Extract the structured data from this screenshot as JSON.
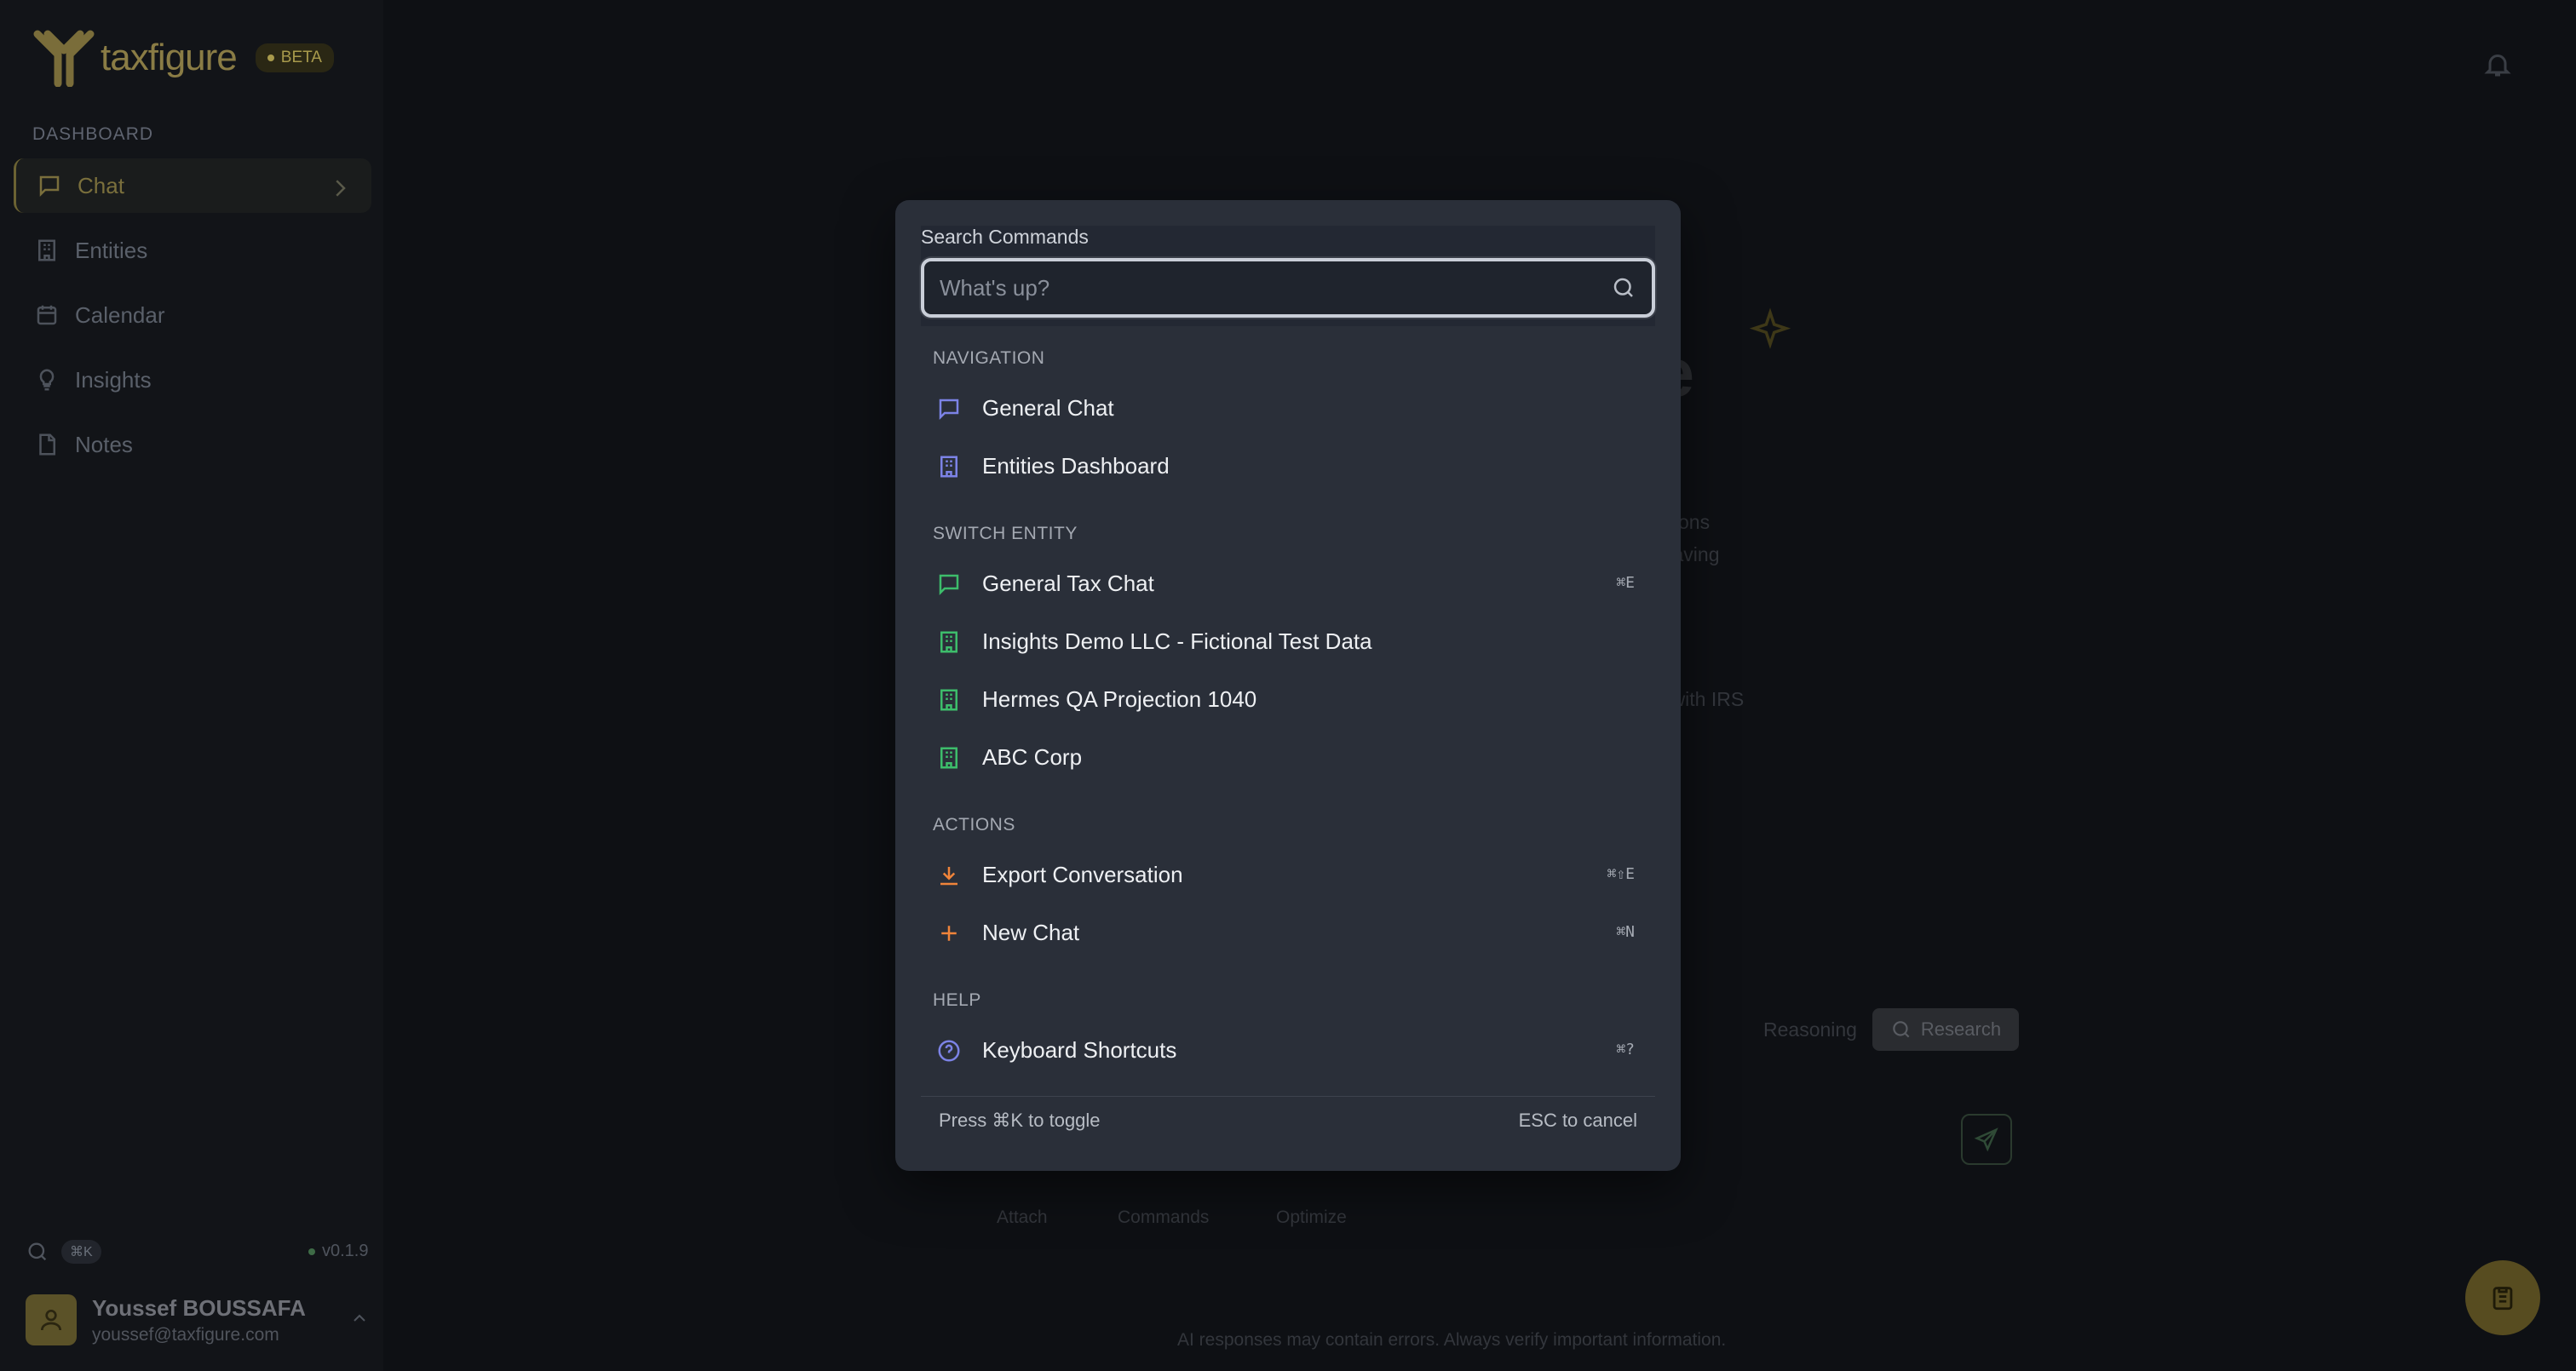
{
  "brand": {
    "name": "taxfigure",
    "badge": "BETA"
  },
  "sidebar": {
    "section_label": "DASHBOARD",
    "items": [
      {
        "label": "Chat",
        "icon": "chat-bubble-icon"
      },
      {
        "label": "Entities",
        "icon": "building-icon"
      },
      {
        "label": "Calendar",
        "icon": "calendar-icon"
      },
      {
        "label": "Insights",
        "icon": "lightbulb-icon"
      },
      {
        "label": "Notes",
        "icon": "note-icon"
      }
    ],
    "search_shortcut": "⌘K",
    "version": "v0.1.9",
    "user": {
      "name": "Youssef BOUSSAFA",
      "email": "youssef@taxfigure.com"
    }
  },
  "background": {
    "hero_text": "ce",
    "line1": "ons",
    "line2": "saving",
    "line3": "nt with IRS",
    "mode_reasoning": "Reasoning",
    "mode_research": "Research",
    "footer_attach": "Attach",
    "footer_commands": "Commands",
    "footer_optimize": "Optimize",
    "disclaimer": "AI responses may contain errors. Always verify important information."
  },
  "palette": {
    "search_label": "Search Commands",
    "search_placeholder": "What's up?",
    "groups": [
      {
        "label": "NAVIGATION",
        "items": [
          {
            "label": "General Chat",
            "icon": "chat-bubble-icon",
            "shortcut": ""
          },
          {
            "label": "Entities Dashboard",
            "icon": "building-icon",
            "shortcut": ""
          }
        ]
      },
      {
        "label": "SWITCH ENTITY",
        "items": [
          {
            "label": "General Tax Chat",
            "icon": "chat-bubble-icon",
            "shortcut": "⌘E"
          },
          {
            "label": "Insights Demo LLC - Fictional Test Data",
            "icon": "building-icon",
            "shortcut": ""
          },
          {
            "label": "Hermes QA Projection 1040",
            "icon": "building-icon",
            "shortcut": ""
          },
          {
            "label": "ABC Corp",
            "icon": "building-icon",
            "shortcut": ""
          }
        ]
      },
      {
        "label": "ACTIONS",
        "items": [
          {
            "label": "Export Conversation",
            "icon": "download-icon",
            "shortcut": "⌘⇧E"
          },
          {
            "label": "New Chat",
            "icon": "plus-icon",
            "shortcut": "⌘N"
          }
        ]
      },
      {
        "label": "HELP",
        "items": [
          {
            "label": "Keyboard Shortcuts",
            "icon": "help-circle-icon",
            "shortcut": "⌘?"
          }
        ]
      }
    ],
    "footer_hint": "Press ⌘K to toggle",
    "footer_cancel": "ESC to cancel"
  },
  "colors": {
    "accent_gold": "#8a7c45",
    "nav_icon_blue": "#7c83e6",
    "entity_icon_green": "#3dbd6b",
    "action_icon_orange": "#f0843a",
    "palette_bg": "#2a2f39"
  }
}
